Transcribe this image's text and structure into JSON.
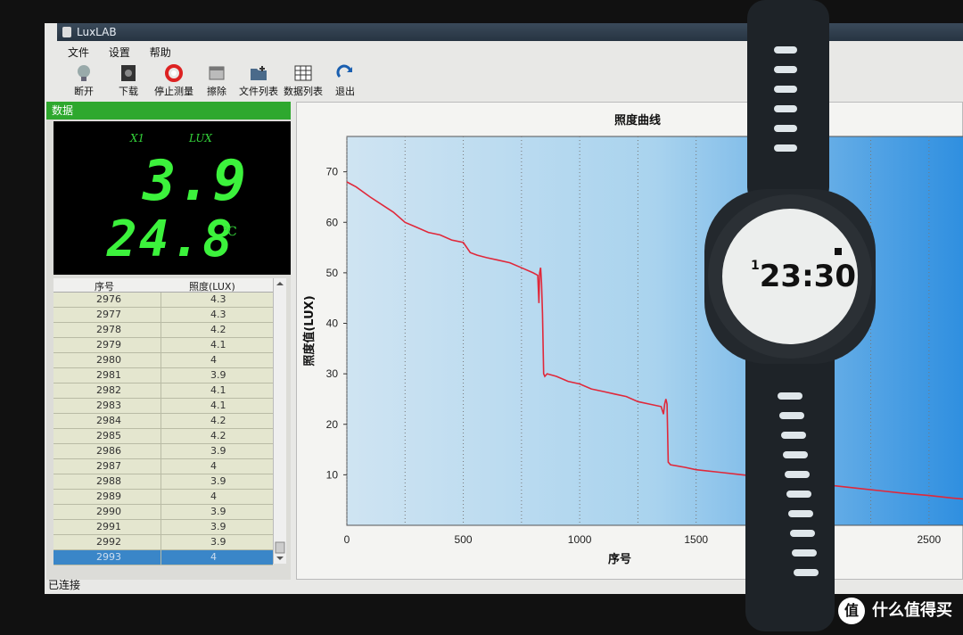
{
  "window": {
    "title": "LuxLAB"
  },
  "menu": [
    "文件",
    "设置",
    "帮助"
  ],
  "toolbar": [
    {
      "label": "断开",
      "icon": "bulb-icon"
    },
    {
      "label": "下载",
      "icon": "download-icon"
    },
    {
      "label": "停止测量",
      "icon": "lifebuoy-icon"
    },
    {
      "label": "擦除",
      "icon": "erase-icon"
    },
    {
      "label": "文件列表",
      "icon": "folder-add-icon"
    },
    {
      "label": "数据列表",
      "icon": "table-icon"
    },
    {
      "label": "退出",
      "icon": "exit-arrow-icon"
    }
  ],
  "panel": {
    "header": "数据"
  },
  "display": {
    "channel": "X1",
    "unit": "LUX",
    "lux": "3.9",
    "temp": "24.8",
    "temp_unit": "℃"
  },
  "table": {
    "headers": [
      "序号",
      "照度(LUX)"
    ],
    "rows": [
      [
        "2976",
        "4.3"
      ],
      [
        "2977",
        "4.3"
      ],
      [
        "2978",
        "4.2"
      ],
      [
        "2979",
        "4.1"
      ],
      [
        "2980",
        "4"
      ],
      [
        "2981",
        "3.9"
      ],
      [
        "2982",
        "4.1"
      ],
      [
        "2983",
        "4.1"
      ],
      [
        "2984",
        "4.2"
      ],
      [
        "2985",
        "4.2"
      ],
      [
        "2986",
        "3.9"
      ],
      [
        "2987",
        "4"
      ],
      [
        "2988",
        "3.9"
      ],
      [
        "2989",
        "4"
      ],
      [
        "2990",
        "3.9"
      ],
      [
        "2991",
        "3.9"
      ],
      [
        "2992",
        "3.9"
      ],
      [
        "2993",
        "4"
      ]
    ],
    "selected_index": 17
  },
  "status": "已连接",
  "watch": {
    "time": "23:30",
    "prefix": "1"
  },
  "watermark": {
    "text": "什么值得买",
    "badge": "值"
  },
  "colors": {
    "series": "#e0283a",
    "lcd": "#3cf23c",
    "header_green": "#2ea82e"
  },
  "chart_data": {
    "type": "line",
    "title": "照度曲线",
    "xlabel": "序号",
    "ylabel": "照度值(LUX)",
    "xlim": [
      0,
      2650
    ],
    "ylim": [
      0,
      77
    ],
    "xticks": [
      0,
      500,
      1000,
      1500,
      2500
    ],
    "yticks": [
      10,
      20,
      30,
      40,
      50,
      60,
      70
    ],
    "grid": "vertical dotted",
    "series": [
      {
        "x": [
          0,
          40,
          100,
          150,
          200,
          250,
          300,
          350,
          400,
          450,
          500,
          530,
          560,
          600,
          650,
          700,
          750,
          800,
          820,
          825,
          828,
          832,
          836,
          840,
          845,
          850,
          860,
          900,
          950,
          1000,
          1050,
          1100,
          1150,
          1200,
          1250,
          1300,
          1350,
          1360,
          1365,
          1370,
          1375,
          1380,
          1390,
          1450,
          1500,
          1600,
          1700,
          1800,
          1900,
          2000,
          2100,
          2200,
          2300,
          2400,
          2500,
          2600,
          2650
        ],
        "y": [
          68,
          67,
          65,
          63.5,
          62,
          60,
          59,
          58,
          57.5,
          56.5,
          56,
          54,
          53.5,
          53,
          52.5,
          52,
          51,
          50,
          49.5,
          44,
          50,
          51,
          48,
          42,
          30,
          29.5,
          30,
          29.5,
          28.5,
          28,
          27,
          26.5,
          26,
          25.5,
          24.5,
          24,
          23.5,
          22,
          24,
          25,
          24,
          12.5,
          12,
          11.5,
          11,
          10.5,
          10,
          9.5,
          9,
          8.3,
          7.8,
          7.3,
          6.8,
          6.3,
          5.9,
          5.4,
          5.2
        ]
      }
    ]
  }
}
